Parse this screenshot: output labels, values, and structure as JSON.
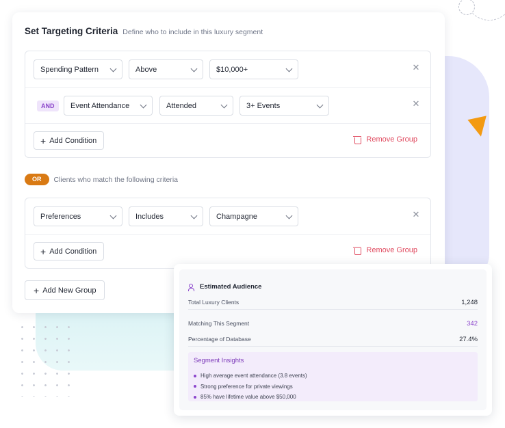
{
  "colors": {
    "accent_purple": "#8b44cc",
    "or_orange": "#d97a14",
    "remove_red": "#e04a5f",
    "triangle": "#f39a12"
  },
  "header": {
    "title": "Set Targeting Criteria",
    "subtitle": "Define who to include in this luxury segment"
  },
  "group1": {
    "row1": {
      "field": "Spending Pattern",
      "operator": "Above",
      "value": "$10,000+"
    },
    "row2": {
      "connector": "AND",
      "field": "Event Attendance",
      "operator": "Attended",
      "value": "3+ Events"
    },
    "add_condition": "Add Condition",
    "remove_group": "Remove Group"
  },
  "or_separator": {
    "label": "OR",
    "text": "Clients who match the following criteria"
  },
  "group2": {
    "row1": {
      "field": "Preferences",
      "operator": "Includes",
      "value": "Champagne"
    },
    "add_condition": "Add Condition",
    "remove_group": "Remove Group"
  },
  "add_new_group": "Add New Group",
  "audience": {
    "title": "Estimated Audience",
    "total_label": "Total Luxury Clients",
    "total_value": "1,248",
    "matching_label": "Matching This Segment",
    "matching_value": "342",
    "percent_label": "Percentage of Database",
    "percent_value": "27.4%",
    "insights_title": "Segment Insights",
    "insights": [
      "High average event attendance (3.8 events)",
      "Strong preference for private viewings",
      "85% have lifetime value above $50,000"
    ]
  }
}
